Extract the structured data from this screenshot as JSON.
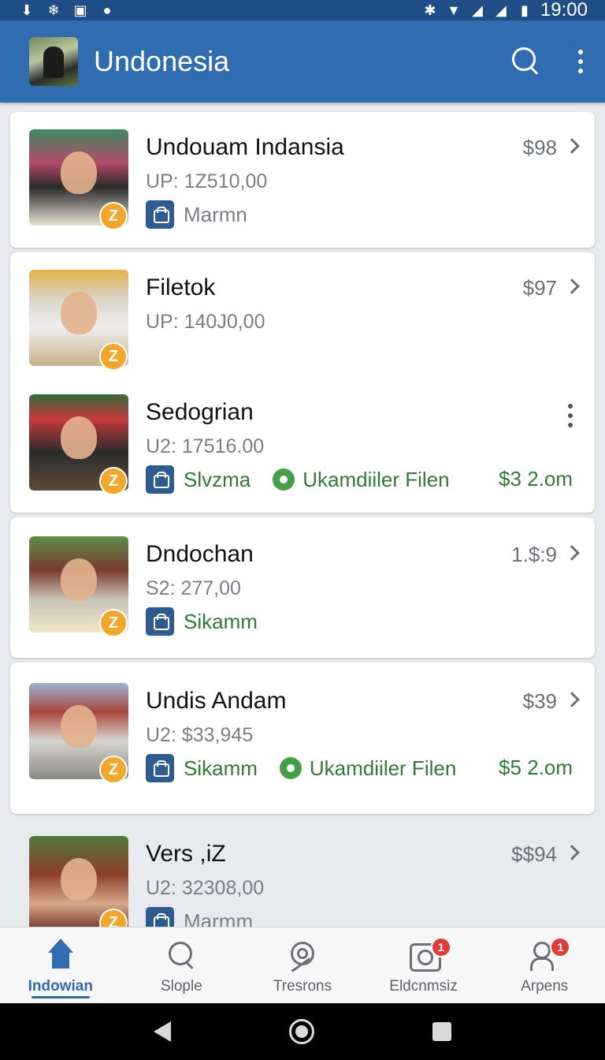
{
  "status_bar": {
    "time": "19:00",
    "left_icons": [
      "download-icon",
      "snowflake-icon",
      "sim-icon",
      "chat-icon"
    ],
    "right_icons": [
      "bluetooth-icon",
      "wifi-icon",
      "signal-icon",
      "signal-icon",
      "battery-icon"
    ]
  },
  "app_bar": {
    "title": "Undonesia",
    "actions": [
      "search-icon",
      "more-vert-icon"
    ]
  },
  "list": {
    "entries": [
      {
        "title": "Undouam Indansia",
        "subtitle": "UP: 1Z510,00",
        "price": "$98",
        "meta_label": "Marmn"
      },
      {
        "title": "Filetok",
        "subtitle": "UP: 140J0,00",
        "price": "$97"
      },
      {
        "title": "Sedogrian",
        "subtitle": "U2: 17516.00",
        "meta_label": "Slvzma",
        "meta_status": "Ukamdiiler Filen",
        "meta_amount": "$3 2.om"
      },
      {
        "title": "Dndochan",
        "subtitle": "S2: 277,00",
        "price": "1.$:9",
        "meta_label": "Sikamm"
      },
      {
        "title": "Undis Andam",
        "subtitle": "U2: $33,945",
        "price": "$39",
        "meta_label": "Sikamm",
        "meta_status": "Ukamdiiler Filen",
        "meta_amount": "$5 2.om"
      },
      {
        "title": "Vers ,iZ",
        "subtitle": "U2: 32308,00",
        "price": "$$94",
        "meta_label": "Marmm"
      }
    ],
    "badge_glyph": "Z"
  },
  "bottom_nav": {
    "items": [
      {
        "label": "Indowian",
        "icon": "home-icon",
        "active": true
      },
      {
        "label": "Slople",
        "icon": "search-icon"
      },
      {
        "label": "Tresrons",
        "icon": "target-icon"
      },
      {
        "label": "Eldcnmsiz",
        "icon": "camera-icon",
        "badge": "1"
      },
      {
        "label": "Arpens",
        "icon": "people-icon",
        "badge": "1"
      }
    ]
  },
  "colors": {
    "app_bar": "#2f6db0",
    "status_bar": "#1f4e86",
    "green_text": "#2e7d32",
    "badge_orange": "#f2a72a",
    "notification_red": "#e53935"
  }
}
